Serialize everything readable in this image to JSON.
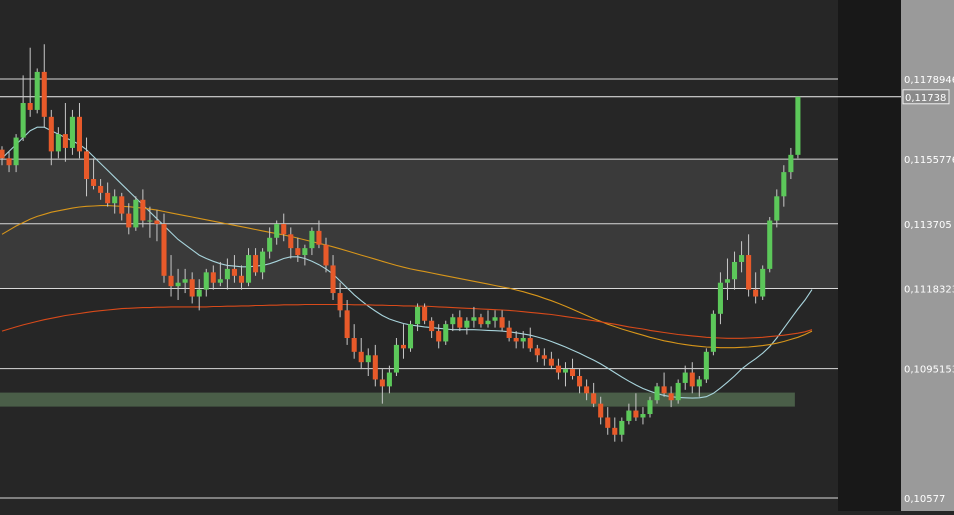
{
  "chart_data": {
    "type": "candlestick",
    "ylim": [
      0.1049,
      0.12
    ],
    "x_count": 116,
    "price_levels": [
      {
        "label": "0,1178946",
        "value": 0.1178946
      },
      {
        "label": "0,1155776",
        "value": 0.1155776
      },
      {
        "label": "0,113705",
        "value": 0.113705
      },
      {
        "label": "0,1118323",
        "value": 0.1118323
      },
      {
        "label": "0,1095153",
        "value": 0.1095153
      },
      {
        "label": "0,10577",
        "value": 0.10577
      }
    ],
    "current_price": {
      "label": "0,11738",
      "value": 0.11738
    },
    "bands": [
      {
        "from": 0.1118323,
        "to": 0.1155776,
        "color": "#3a3a3a"
      }
    ],
    "support_zone": {
      "from_index": 0,
      "to_index": 112,
      "low": 0.10865,
      "high": 0.10882,
      "color": "#4a5e48"
    },
    "candles": [
      [
        0.11585,
        0.11595,
        0.1154,
        0.1156
      ],
      [
        0.1156,
        0.1158,
        0.1152,
        0.1154
      ],
      [
        0.1154,
        0.1163,
        0.1152,
        0.1162
      ],
      [
        0.1162,
        0.118,
        0.1161,
        0.1172
      ],
      [
        0.1172,
        0.1188,
        0.1168,
        0.117
      ],
      [
        0.117,
        0.1182,
        0.1169,
        0.1181
      ],
      [
        0.1181,
        0.1189,
        0.1165,
        0.1168
      ],
      [
        0.1168,
        0.117,
        0.1154,
        0.1158
      ],
      [
        0.1158,
        0.1165,
        0.1156,
        0.1163
      ],
      [
        0.1163,
        0.1172,
        0.1155,
        0.1159
      ],
      [
        0.1159,
        0.117,
        0.1157,
        0.1168
      ],
      [
        0.1168,
        0.1172,
        0.1156,
        0.1158
      ],
      [
        0.1158,
        0.1162,
        0.1145,
        0.115
      ],
      [
        0.115,
        0.1156,
        0.1147,
        0.1148
      ],
      [
        0.1148,
        0.115,
        0.1144,
        0.1146
      ],
      [
        0.1146,
        0.1149,
        0.1142,
        0.1143
      ],
      [
        0.1143,
        0.1147,
        0.114,
        0.1145
      ],
      [
        0.1145,
        0.1146,
        0.1138,
        0.114
      ],
      [
        0.114,
        0.1143,
        0.1134,
        0.1136
      ],
      [
        0.1136,
        0.1145,
        0.1135,
        0.1144
      ],
      [
        0.1144,
        0.1147,
        0.1136,
        0.1138
      ],
      [
        0.1138,
        0.1142,
        0.1133,
        0.1138
      ],
      [
        0.1138,
        0.1141,
        0.1132,
        0.1137
      ],
      [
        0.1137,
        0.114,
        0.112,
        0.1122
      ],
      [
        0.1122,
        0.1128,
        0.1116,
        0.1119
      ],
      [
        0.1119,
        0.1124,
        0.1115,
        0.112
      ],
      [
        0.112,
        0.1124,
        0.1117,
        0.1121
      ],
      [
        0.1121,
        0.1123,
        0.1114,
        0.1116
      ],
      [
        0.1116,
        0.1121,
        0.1112,
        0.1118
      ],
      [
        0.1118,
        0.1124,
        0.1116,
        0.1123
      ],
      [
        0.1123,
        0.1125,
        0.1118,
        0.112
      ],
      [
        0.112,
        0.1126,
        0.1119,
        0.1121
      ],
      [
        0.1121,
        0.1127,
        0.1118,
        0.1124
      ],
      [
        0.1124,
        0.1128,
        0.112,
        0.1122
      ],
      [
        0.1122,
        0.1125,
        0.1118,
        0.112
      ],
      [
        0.112,
        0.113,
        0.1119,
        0.1128
      ],
      [
        0.1128,
        0.113,
        0.1122,
        0.1123
      ],
      [
        0.1123,
        0.113,
        0.1121,
        0.1129
      ],
      [
        0.1129,
        0.1136,
        0.1127,
        0.1133
      ],
      [
        0.1133,
        0.1138,
        0.1131,
        0.1137
      ],
      [
        0.1137,
        0.114,
        0.1132,
        0.1134
      ],
      [
        0.1134,
        0.1136,
        0.1127,
        0.113
      ],
      [
        0.113,
        0.1133,
        0.1126,
        0.1128
      ],
      [
        0.1128,
        0.1131,
        0.1125,
        0.113
      ],
      [
        0.113,
        0.1136,
        0.1128,
        0.1135
      ],
      [
        0.1135,
        0.1138,
        0.113,
        0.1131
      ],
      [
        0.1131,
        0.1133,
        0.1123,
        0.1125
      ],
      [
        0.1125,
        0.1128,
        0.1115,
        0.1117
      ],
      [
        0.1117,
        0.112,
        0.111,
        0.1112
      ],
      [
        0.1112,
        0.1115,
        0.1102,
        0.1104
      ],
      [
        0.1104,
        0.1108,
        0.1098,
        0.11
      ],
      [
        0.11,
        0.1104,
        0.1095,
        0.1097
      ],
      [
        0.1097,
        0.1101,
        0.1093,
        0.1099
      ],
      [
        0.1099,
        0.1102,
        0.109,
        0.1092
      ],
      [
        0.1092,
        0.1095,
        0.1085,
        0.109
      ],
      [
        0.109,
        0.1096,
        0.1088,
        0.1094
      ],
      [
        0.1094,
        0.1104,
        0.1093,
        0.1102
      ],
      [
        0.1102,
        0.1108,
        0.1098,
        0.1101
      ],
      [
        0.1101,
        0.1109,
        0.11,
        0.1108
      ],
      [
        0.1108,
        0.1114,
        0.1106,
        0.1113
      ],
      [
        0.1113,
        0.1114,
        0.1108,
        0.1109
      ],
      [
        0.1109,
        0.111,
        0.1104,
        0.1106
      ],
      [
        0.1106,
        0.1108,
        0.1101,
        0.1103
      ],
      [
        0.1103,
        0.1109,
        0.1102,
        0.1108
      ],
      [
        0.1108,
        0.1111,
        0.1106,
        0.111
      ],
      [
        0.111,
        0.1112,
        0.1106,
        0.1107
      ],
      [
        0.1107,
        0.111,
        0.1105,
        0.1109
      ],
      [
        0.1109,
        0.1113,
        0.1107,
        0.111
      ],
      [
        0.111,
        0.1111,
        0.1107,
        0.1108
      ],
      [
        0.1108,
        0.1112,
        0.1107,
        0.1109
      ],
      [
        0.1109,
        0.1112,
        0.1107,
        0.111
      ],
      [
        0.111,
        0.1112,
        0.1106,
        0.1107
      ],
      [
        0.1107,
        0.1109,
        0.1103,
        0.1104
      ],
      [
        0.1104,
        0.1106,
        0.1101,
        0.1103
      ],
      [
        0.1103,
        0.1106,
        0.1101,
        0.1104
      ],
      [
        0.1104,
        0.1107,
        0.11,
        0.1101
      ],
      [
        0.1101,
        0.1102,
        0.1097,
        0.1099
      ],
      [
        0.1099,
        0.1101,
        0.1096,
        0.1098
      ],
      [
        0.1098,
        0.11,
        0.1095,
        0.1096
      ],
      [
        0.1096,
        0.1098,
        0.1092,
        0.1094
      ],
      [
        0.1094,
        0.1097,
        0.109,
        0.1095
      ],
      [
        0.1095,
        0.1098,
        0.1092,
        0.1093
      ],
      [
        0.1093,
        0.1095,
        0.1088,
        0.109
      ],
      [
        0.109,
        0.1092,
        0.1086,
        0.1088
      ],
      [
        0.1088,
        0.1091,
        0.1084,
        0.1085
      ],
      [
        0.1085,
        0.1087,
        0.1079,
        0.1081
      ],
      [
        0.1081,
        0.1084,
        0.1076,
        0.1078
      ],
      [
        0.1078,
        0.1081,
        0.1074,
        0.1076
      ],
      [
        0.1076,
        0.1081,
        0.1074,
        0.108
      ],
      [
        0.108,
        0.1085,
        0.1079,
        0.1083
      ],
      [
        0.1083,
        0.1088,
        0.108,
        0.1081
      ],
      [
        0.1081,
        0.1084,
        0.1079,
        0.1082
      ],
      [
        0.1082,
        0.1087,
        0.1081,
        0.1086
      ],
      [
        0.1086,
        0.1091,
        0.1085,
        0.109
      ],
      [
        0.109,
        0.1094,
        0.1087,
        0.1088
      ],
      [
        0.1088,
        0.109,
        0.1084,
        0.1086
      ],
      [
        0.1086,
        0.1092,
        0.1085,
        0.1091
      ],
      [
        0.1091,
        0.1096,
        0.1089,
        0.1094
      ],
      [
        0.1094,
        0.1097,
        0.1088,
        0.109
      ],
      [
        0.109,
        0.1093,
        0.1087,
        0.1092
      ],
      [
        0.1092,
        0.1101,
        0.1091,
        0.11
      ],
      [
        0.11,
        0.1112,
        0.1099,
        0.1111
      ],
      [
        0.1111,
        0.1123,
        0.1108,
        0.112
      ],
      [
        0.112,
        0.1127,
        0.1115,
        0.1121
      ],
      [
        0.1121,
        0.1129,
        0.1118,
        0.1126
      ],
      [
        0.1126,
        0.1132,
        0.1123,
        0.1128
      ],
      [
        0.1128,
        0.1134,
        0.1116,
        0.1118
      ],
      [
        0.1118,
        0.1123,
        0.1114,
        0.1116
      ],
      [
        0.1116,
        0.1125,
        0.1115,
        0.1124
      ],
      [
        0.1124,
        0.1139,
        0.1123,
        0.1138
      ],
      [
        0.1138,
        0.1147,
        0.1136,
        0.1145
      ],
      [
        0.1145,
        0.1154,
        0.1142,
        0.1152
      ],
      [
        0.1152,
        0.1159,
        0.115,
        0.1157
      ],
      [
        0.1157,
        0.117,
        0.1156,
        0.11738
      ]
    ],
    "moving_averages": [
      {
        "color": "#a8d4dc",
        "values": [
          0.1156,
          0.1158,
          0.116,
          0.1162,
          0.1164,
          0.1165,
          0.1165,
          0.1164,
          0.1163,
          0.1162,
          0.1161,
          0.116,
          0.11585,
          0.11565,
          0.11545,
          0.11525,
          0.11505,
          0.11485,
          0.11465,
          0.11445,
          0.11425,
          0.11405,
          0.11385,
          0.11365,
          0.11345,
          0.11325,
          0.1131,
          0.11295,
          0.1128,
          0.1127,
          0.11262,
          0.11255,
          0.1125,
          0.11248,
          0.11246,
          0.11246,
          0.11248,
          0.1125,
          0.11255,
          0.11262,
          0.1127,
          0.11275,
          0.11275,
          0.1127,
          0.11262,
          0.11252,
          0.1124,
          0.11225,
          0.11205,
          0.11185,
          0.11165,
          0.11148,
          0.11132,
          0.11118,
          0.11105,
          0.11095,
          0.11088,
          0.11082,
          0.11078,
          0.11075,
          0.11072,
          0.1107,
          0.11068,
          0.11066,
          0.11064,
          0.11064,
          0.11064,
          0.11064,
          0.11063,
          0.11062,
          0.11061,
          0.1106,
          0.11058,
          0.11055,
          0.11052,
          0.11048,
          0.11043,
          0.11037,
          0.1103,
          0.11022,
          0.11014,
          0.11005,
          0.10996,
          0.10986,
          0.10976,
          0.10965,
          0.10953,
          0.1094,
          0.10927,
          0.10915,
          0.10904,
          0.10894,
          0.10886,
          0.10879,
          0.10874,
          0.1087,
          0.10868,
          0.10867,
          0.10866,
          0.10867,
          0.1087,
          0.1088,
          0.10895,
          0.10912,
          0.1093,
          0.1095,
          0.10966,
          0.1098,
          0.10996,
          0.11015,
          0.1104,
          0.11068,
          0.11096,
          0.11124,
          0.1115,
          0.1118
        ]
      },
      {
        "color": "#d8961a",
        "values": [
          0.1134,
          0.11352,
          0.11364,
          0.11374,
          0.11384,
          0.11392,
          0.11398,
          0.11404,
          0.11408,
          0.11412,
          0.11416,
          0.11419,
          0.11421,
          0.11422,
          0.11423,
          0.11423,
          0.11422,
          0.11421,
          0.1142,
          0.11418,
          0.11416,
          0.11413,
          0.1141,
          0.11406,
          0.11402,
          0.11398,
          0.11394,
          0.1139,
          0.11386,
          0.11382,
          0.11378,
          0.11374,
          0.1137,
          0.11366,
          0.11362,
          0.11358,
          0.11354,
          0.1135,
          0.11346,
          0.11342,
          0.11338,
          0.11334,
          0.11329,
          0.11324,
          0.11319,
          0.11314,
          0.11309,
          0.11304,
          0.11298,
          0.11292,
          0.11286,
          0.1128,
          0.11274,
          0.11268,
          0.11262,
          0.11256,
          0.1125,
          0.11245,
          0.1124,
          0.11236,
          0.11232,
          0.11228,
          0.11224,
          0.1122,
          0.11216,
          0.11212,
          0.11208,
          0.11204,
          0.112,
          0.11196,
          0.11192,
          0.11188,
          0.11184,
          0.11179,
          0.11174,
          0.11168,
          0.11162,
          0.11155,
          0.11148,
          0.1114,
          0.11132,
          0.11123,
          0.11114,
          0.11105,
          0.11096,
          0.11088,
          0.1108,
          0.11073,
          0.11066,
          0.1106,
          0.11054,
          0.11048,
          0.11042,
          0.11037,
          0.11032,
          0.11028,
          0.11024,
          0.11021,
          0.11018,
          0.11016,
          0.11014,
          0.11013,
          0.11012,
          0.11012,
          0.11012,
          0.11013,
          0.11014,
          0.11016,
          0.11018,
          0.11021,
          0.11025,
          0.1103,
          0.11036,
          0.11042,
          0.1105,
          0.1106
        ]
      },
      {
        "color": "#d84a1a",
        "values": [
          0.1106,
          0.11066,
          0.11072,
          0.11078,
          0.11083,
          0.11088,
          0.11093,
          0.11097,
          0.11101,
          0.11105,
          0.11108,
          0.11111,
          0.11114,
          0.11117,
          0.11119,
          0.11121,
          0.11123,
          0.11125,
          0.11126,
          0.11127,
          0.11128,
          0.11128,
          0.11129,
          0.11129,
          0.1113,
          0.1113,
          0.1113,
          0.1113,
          0.1113,
          0.1113,
          0.11131,
          0.11131,
          0.11132,
          0.11132,
          0.11133,
          0.11133,
          0.11134,
          0.11134,
          0.11135,
          0.11135,
          0.11136,
          0.11136,
          0.11136,
          0.11137,
          0.11137,
          0.11137,
          0.11137,
          0.11137,
          0.11137,
          0.11137,
          0.11136,
          0.11136,
          0.11136,
          0.11135,
          0.11135,
          0.11134,
          0.11134,
          0.11133,
          0.11133,
          0.11132,
          0.11132,
          0.11131,
          0.1113,
          0.11129,
          0.11128,
          0.11127,
          0.11126,
          0.11125,
          0.11124,
          0.11123,
          0.11122,
          0.11121,
          0.1112,
          0.11118,
          0.11116,
          0.11114,
          0.11112,
          0.1111,
          0.11108,
          0.11105,
          0.11102,
          0.11099,
          0.11096,
          0.11093,
          0.1109,
          0.11087,
          0.11083,
          0.1108,
          0.11076,
          0.11072,
          0.11069,
          0.11066,
          0.11062,
          0.11059,
          0.11056,
          0.11053,
          0.1105,
          0.11048,
          0.11046,
          0.11044,
          0.11042,
          0.11041,
          0.1104,
          0.11039,
          0.11039,
          0.11039,
          0.1104,
          0.11041,
          0.11042,
          0.11044,
          0.11046,
          0.11048,
          0.11051,
          0.11054,
          0.11058,
          0.11064
        ]
      }
    ],
    "colors": {
      "up": "#5cc85a",
      "down": "#e85a2a",
      "wick": "#c8c8c8",
      "level_line": "#d8d8d8",
      "panel_bg": "#262626",
      "axis_bg": "#9a9a9a",
      "right_strip": "#181818"
    }
  }
}
